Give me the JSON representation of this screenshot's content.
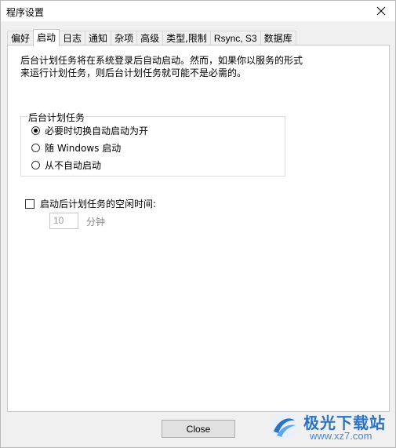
{
  "window": {
    "title": "程序设置"
  },
  "tabs": [
    {
      "label": "偏好"
    },
    {
      "label": "启动",
      "active": true
    },
    {
      "label": "日志"
    },
    {
      "label": "通知"
    },
    {
      "label": "杂项"
    },
    {
      "label": "高级"
    },
    {
      "label": "类型,限制"
    },
    {
      "label": "Rsync, S3"
    },
    {
      "label": "数据库"
    }
  ],
  "startup": {
    "description_line1": "后台计划任务将在系统登录后自动启动。然而，如果你以服务的形式",
    "description_line2": "来运行计划任务，则后台计划任务就可能不是必需的。",
    "group_title": "后台计划任务",
    "options": [
      {
        "label": "必要时切换自动启动为开",
        "checked": true
      },
      {
        "label": "随 Windows 启动",
        "checked": false
      },
      {
        "label": "从不自动启动",
        "checked": false
      }
    ],
    "idle_checkbox_label": "启动后计划任务的空闲时间:",
    "idle_checked": false,
    "idle_value": "10",
    "idle_unit": "分钟"
  },
  "footer": {
    "close_label": "Close"
  },
  "watermark": {
    "site_name": "极光下载站",
    "url": "www.xz7.com"
  },
  "colors": {
    "accent": "#2a73c6",
    "panel": "#ffffff",
    "window": "#f0f0f0"
  }
}
